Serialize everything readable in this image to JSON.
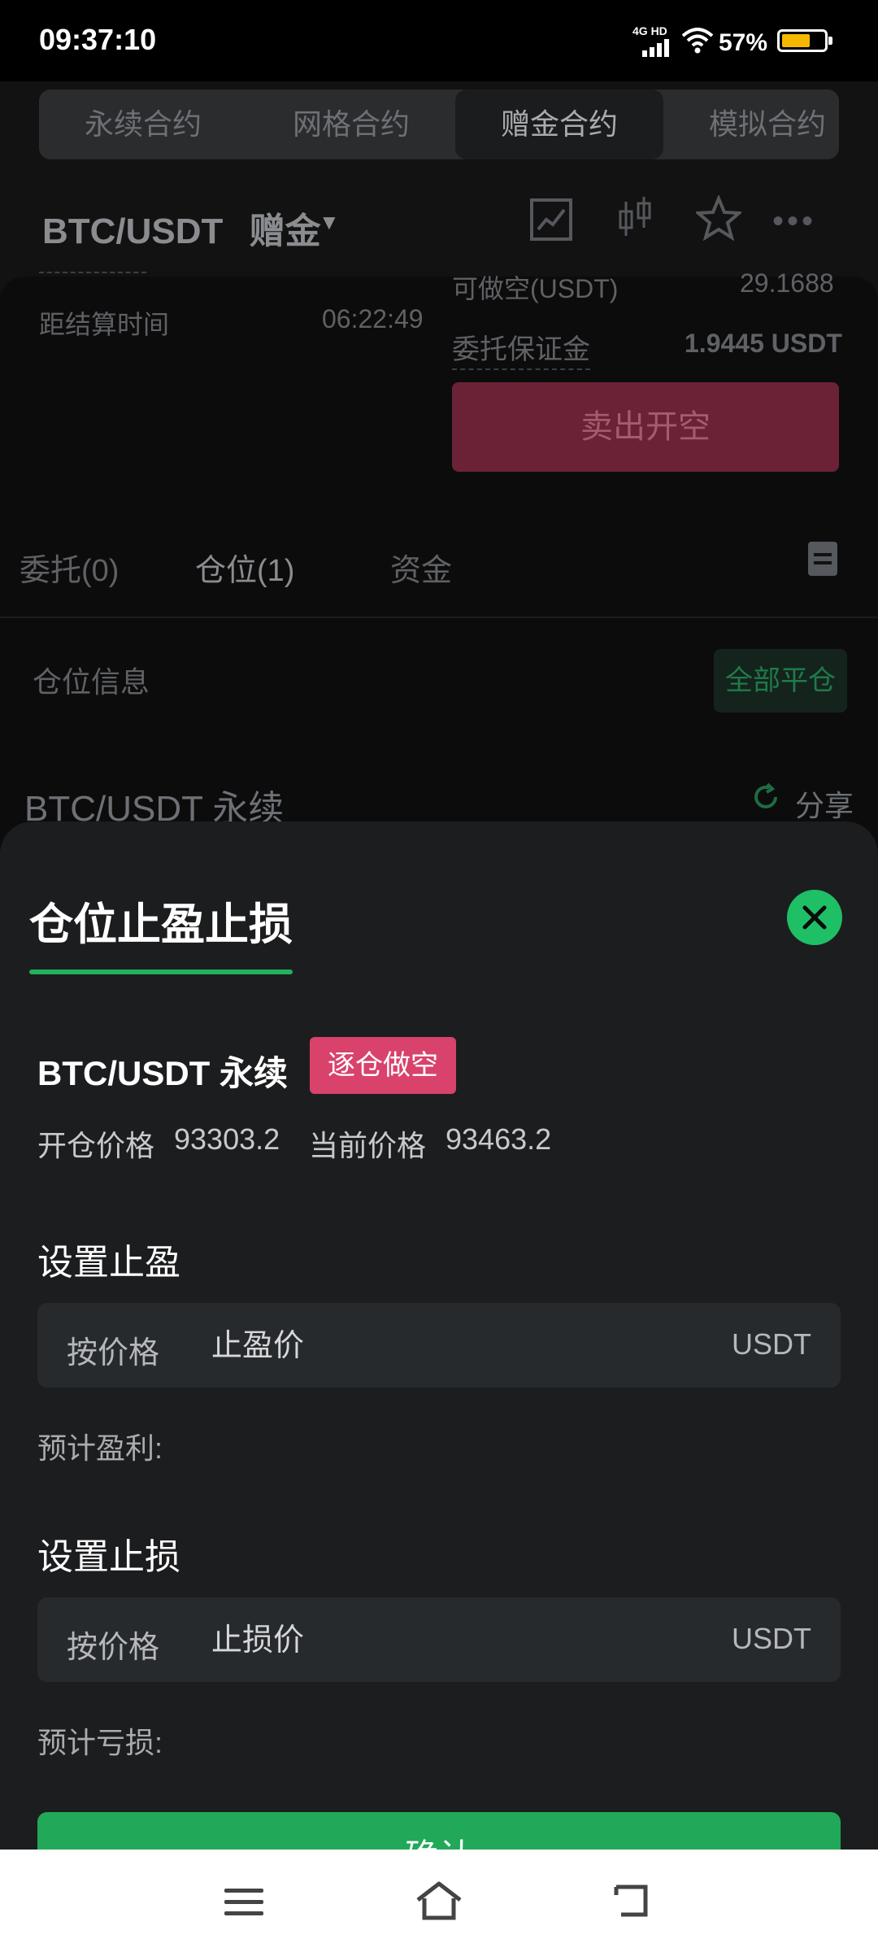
{
  "status_bar": {
    "time": "09:37:10",
    "network": "4G HD",
    "battery": "57%"
  },
  "contract_tabs": [
    "永续合约",
    "网格合约",
    "赠金合约",
    "模拟合约"
  ],
  "active_tab_index": 2,
  "header": {
    "pair": "BTC/USDT",
    "mode": "赠金"
  },
  "trade_panel": {
    "short_available_label": "可做空(USDT)",
    "short_available_value": "29.1688",
    "settlement_label": "距结算时间",
    "settlement_value": "06:22:49",
    "margin_label": "委托保证金",
    "margin_value": "1.9445 USDT",
    "sell_button": "卖出开空"
  },
  "position_tabs": [
    "委托(0)",
    "仓位(1)",
    "资金"
  ],
  "position_info": {
    "label": "仓位信息",
    "close_all": "全部平仓",
    "pair_name": "BTC/USDT 永续",
    "share": "分享"
  },
  "sheet": {
    "title": "仓位止盈止损",
    "pair": "BTC/USDT 永续",
    "badge": "逐仓做空",
    "open_price_label": "开仓价格",
    "open_price": "93303.2",
    "current_price_label": "当前价格",
    "current_price": "93463.2",
    "tp": {
      "title": "设置止盈",
      "mode": "按价格",
      "placeholder": "止盈价",
      "unit": "USDT",
      "estimate_label": "预计盈利:"
    },
    "sl": {
      "title": "设置止损",
      "mode": "按价格",
      "placeholder": "止损价",
      "unit": "USDT",
      "estimate_label": "预计亏损:"
    },
    "confirm": "确认"
  },
  "colors": {
    "accent_green": "#1fbf65",
    "short_red": "#d8426b",
    "sheet_bg": "#1c1d1f"
  }
}
